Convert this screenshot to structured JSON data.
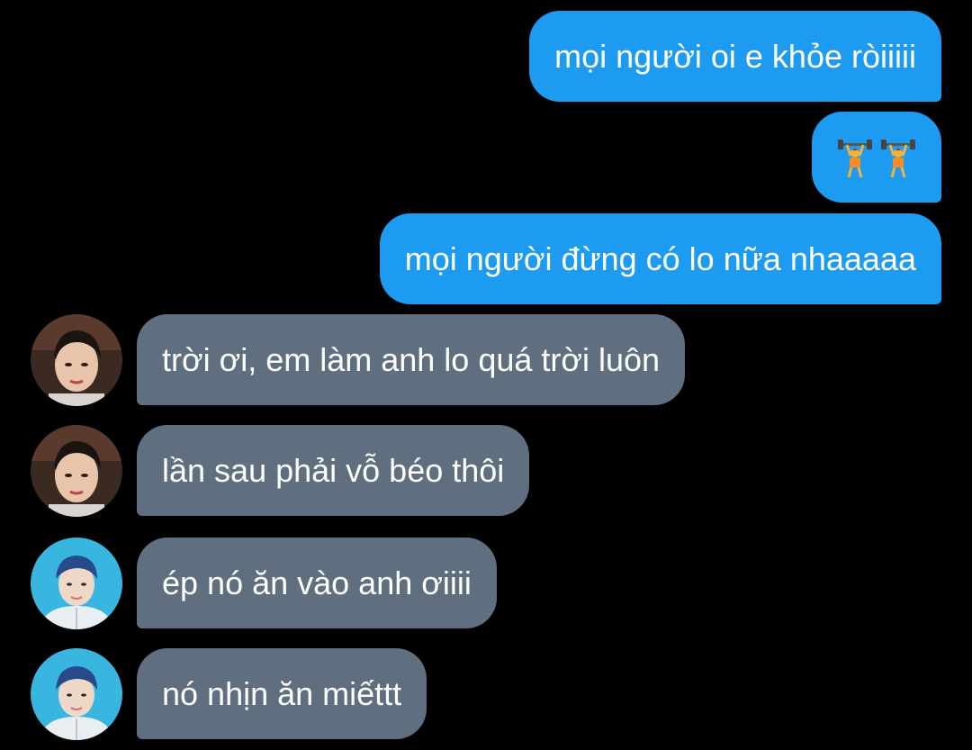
{
  "messages": [
    {
      "direction": "outgoing",
      "text": "mọi người oi e khỏe ròiiiii"
    },
    {
      "direction": "outgoing",
      "emoji": "weightlifter-icon x2"
    },
    {
      "direction": "outgoing",
      "text": "mọi người đừng có lo nữa nhaaaaa"
    },
    {
      "direction": "incoming",
      "avatar": "avatar-1",
      "text": "trời ơi, em làm anh lo quá trời luôn"
    },
    {
      "direction": "incoming",
      "avatar": "avatar-1",
      "text": "lần sau phải vỗ béo thôi"
    },
    {
      "direction": "incoming",
      "avatar": "avatar-2",
      "text": "ép nó ăn vào anh ơiiii"
    },
    {
      "direction": "incoming",
      "avatar": "avatar-2",
      "text": "nó nhịn ăn miếttt"
    }
  ],
  "colors": {
    "background": "#000000",
    "outgoing_bubble": "#1d9bf0",
    "incoming_bubble": "#5f6f80",
    "text": "#ffffff"
  }
}
